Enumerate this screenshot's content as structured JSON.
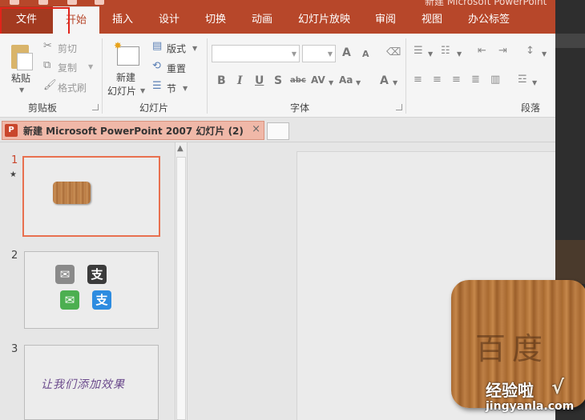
{
  "window": {
    "title": "新建 Microsoft PowerPoint"
  },
  "tabs": [
    {
      "label": "文件"
    },
    {
      "label": "开始"
    },
    {
      "label": "插入"
    },
    {
      "label": "设计"
    },
    {
      "label": "切换"
    },
    {
      "label": "动画"
    },
    {
      "label": "幻灯片放映"
    },
    {
      "label": "审阅"
    },
    {
      "label": "视图"
    },
    {
      "label": "办公标签"
    }
  ],
  "ribbon": {
    "clipboard": {
      "paste": "粘贴",
      "cut": "剪切",
      "copy": "复制",
      "format_painter": "格式刷",
      "group": "剪贴板"
    },
    "slides": {
      "new_slide_line1": "新建",
      "new_slide_line2": "幻灯片",
      "layout": "版式",
      "reset": "重置",
      "section": "节",
      "group": "幻灯片"
    },
    "font": {
      "group": "字体",
      "bold": "B",
      "italic": "I",
      "underline": "U",
      "shadow": "S",
      "strike": "abc",
      "spacing": "AV",
      "case": "Aa",
      "color": "A",
      "grow": "A",
      "shrink": "A"
    },
    "paragraph": {
      "group": "段落"
    }
  },
  "doc_tab": {
    "icon": "P",
    "label": "新建 Microsoft PowerPoint 2007 幻灯片 (2)",
    "close": "×"
  },
  "slides_panel": [
    {
      "number": "1",
      "marker": "★"
    },
    {
      "number": "2",
      "icon1": "支",
      "icon2": "支"
    },
    {
      "number": "3",
      "text": "让我们添加效果"
    }
  ],
  "slide_main": {
    "carved_text": "百度"
  },
  "watermark": {
    "brand": "经验啦",
    "check": "√",
    "domain": "jingyanla.com"
  },
  "colors": {
    "accent": "#b7472a",
    "selection_border": "#e8704f",
    "highlight_box": "#e2231a"
  }
}
